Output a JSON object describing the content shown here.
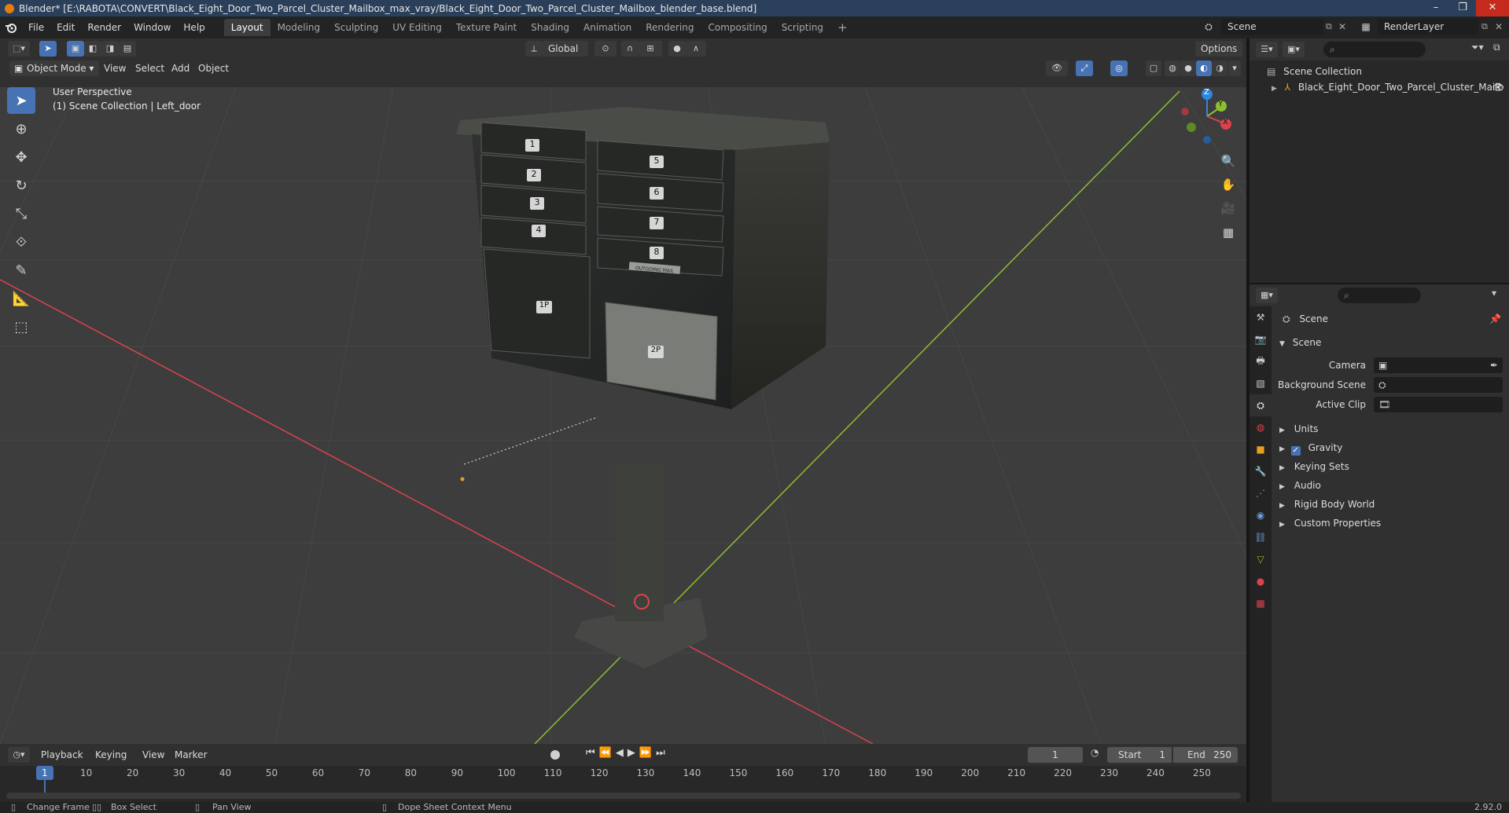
{
  "window": {
    "title": "Blender* [E:\\RABOTA\\CONVERT\\Black_Eight_Door_Two_Parcel_Cluster_Mailbox_max_vray/Black_Eight_Door_Two_Parcel_Cluster_Mailbox_blender_base.blend]"
  },
  "menu": [
    "File",
    "Edit",
    "Render",
    "Window",
    "Help"
  ],
  "workspaces": [
    {
      "label": "Layout",
      "active": true
    },
    {
      "label": "Modeling"
    },
    {
      "label": "Sculpting"
    },
    {
      "label": "UV Editing"
    },
    {
      "label": "Texture Paint"
    },
    {
      "label": "Shading"
    },
    {
      "label": "Animation"
    },
    {
      "label": "Rendering"
    },
    {
      "label": "Compositing"
    },
    {
      "label": "Scripting"
    }
  ],
  "scene_selector": {
    "value": "Scene"
  },
  "renderlayer_selector": {
    "value": "RenderLayer"
  },
  "viewport_header": {
    "transform_orientation": "Global",
    "options_label": "Options",
    "mode": "Object Mode",
    "menus": [
      "View",
      "Select",
      "Add",
      "Object"
    ]
  },
  "viewport_info": {
    "line1": "User Perspective",
    "line2": "(1) Scene Collection | Left_door"
  },
  "mailbox": {
    "small_doors": [
      "1",
      "2",
      "3",
      "4",
      "5",
      "6",
      "7",
      "8"
    ],
    "parcel_doors": [
      "1P",
      "2P"
    ],
    "outgoing_label": "OUTGOING MAIL"
  },
  "gizmo": {
    "x": "X",
    "y": "Y",
    "z": "Z"
  },
  "outliner": {
    "root": "Scene Collection",
    "items": [
      "Black_Eight_Door_Two_Parcel_Cluster_Mailb"
    ]
  },
  "properties": {
    "context_label": "Scene",
    "panel_title": "Scene",
    "fields": [
      {
        "label": "Camera"
      },
      {
        "label": "Background Scene"
      },
      {
        "label": "Active Clip"
      }
    ],
    "subpanels": [
      {
        "label": "Units",
        "checkbox": false
      },
      {
        "label": "Gravity",
        "checkbox": true
      },
      {
        "label": "Keying Sets",
        "checkbox": false
      },
      {
        "label": "Audio",
        "checkbox": false
      },
      {
        "label": "Rigid Body World",
        "checkbox": false
      },
      {
        "label": "Custom Properties",
        "checkbox": false
      }
    ]
  },
  "timeline": {
    "menus": [
      "Playback",
      "Keying",
      "View",
      "Marker"
    ],
    "current_frame": "1",
    "start_label": "Start",
    "start": "1",
    "end_label": "End",
    "end": "250",
    "ticks": [
      "1",
      "10",
      "20",
      "30",
      "40",
      "50",
      "60",
      "70",
      "80",
      "90",
      "100",
      "110",
      "120",
      "130",
      "140",
      "150",
      "160",
      "170",
      "180",
      "190",
      "200",
      "210",
      "220",
      "230",
      "240",
      "250"
    ]
  },
  "statusbar": {
    "items": [
      "Change Frame",
      "Box Select",
      "Pan View",
      "Dope Sheet Context Menu"
    ],
    "version": "2.92.0"
  },
  "colors": {
    "accent": "#4772b3",
    "axis_x": "#d9434d",
    "axis_y": "#8cbf2f",
    "axis_z": "#2f86e0",
    "brand": "#e87d0d"
  }
}
